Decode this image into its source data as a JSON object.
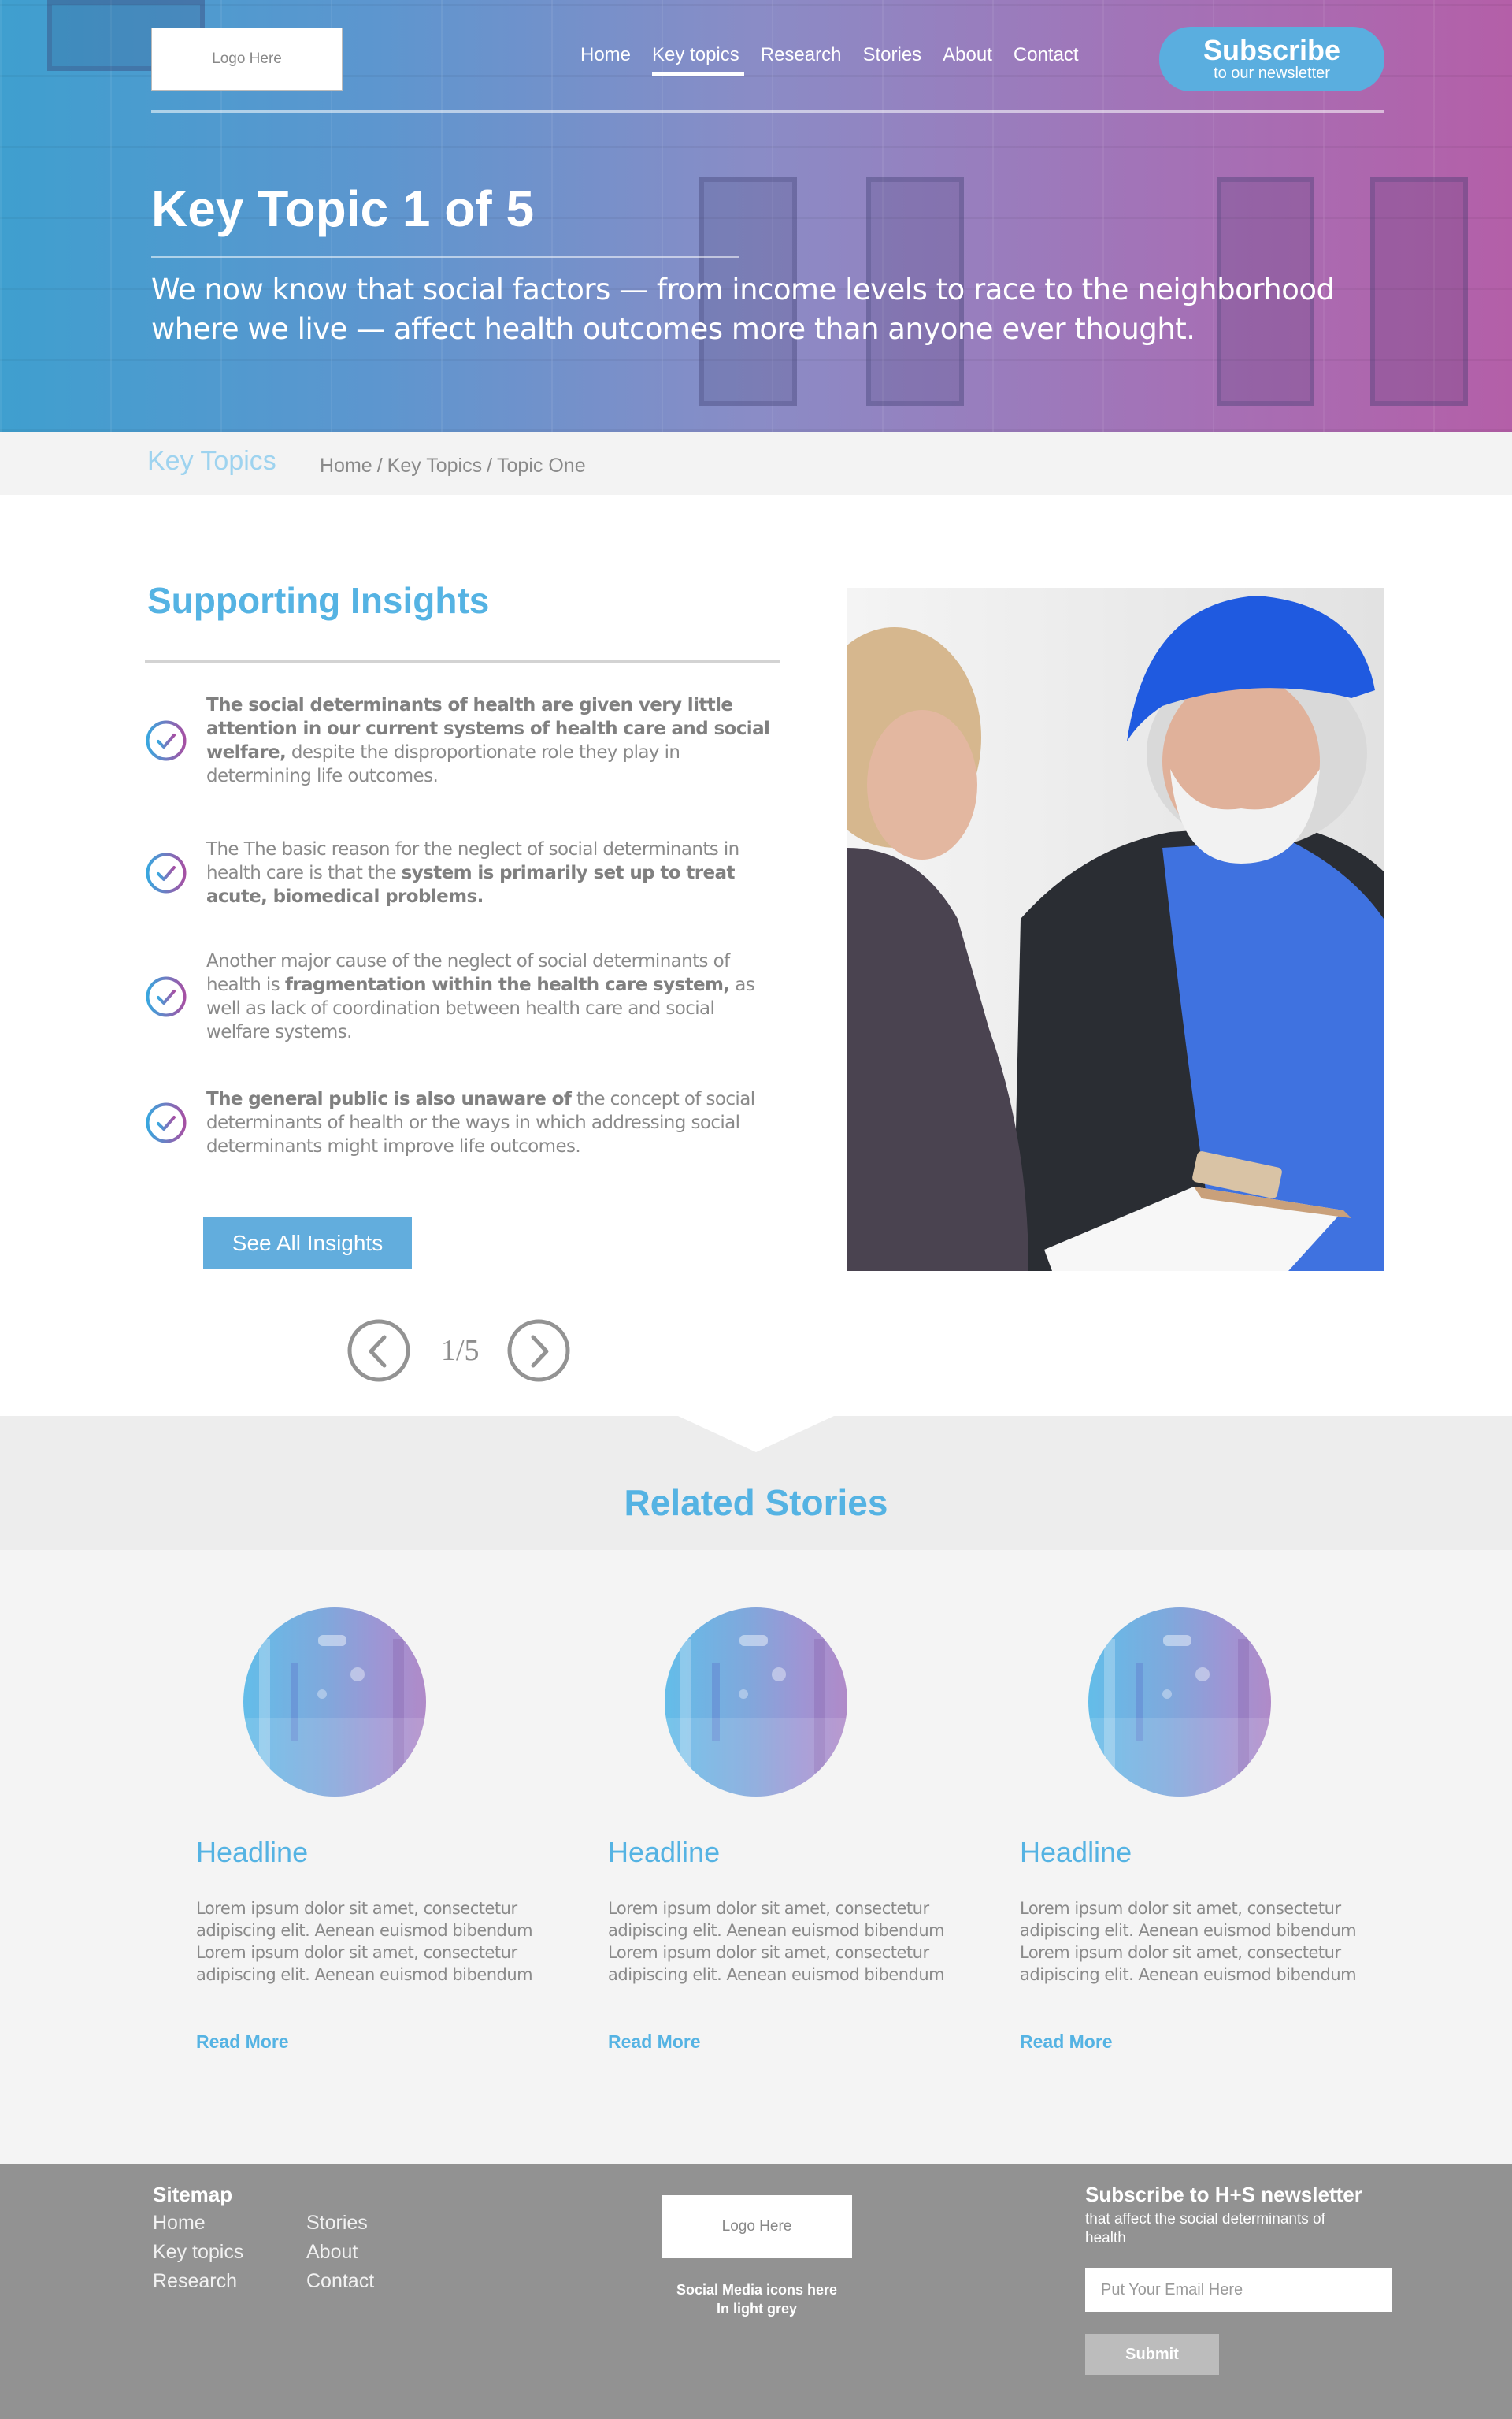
{
  "header": {
    "logo_text": "Logo Here",
    "nav": [
      {
        "label": "Home",
        "active": false
      },
      {
        "label": "Key topics",
        "active": true
      },
      {
        "label": "Research",
        "active": false
      },
      {
        "label": "Stories",
        "active": false
      },
      {
        "label": "About",
        "active": false
      },
      {
        "label": "Contact",
        "active": false
      }
    ],
    "subscribe": {
      "title": "Subscribe",
      "subtitle": "to our newsletter"
    }
  },
  "hero": {
    "title": "Key Topic 1 of 5",
    "description": "We now know that social factors — from income levels to race to the neighborhood where we live — affect health outcomes more than anyone ever thought."
  },
  "crumb_bar": {
    "section_title": "Key Topics",
    "breadcrumb": [
      "Home",
      "Key Topics",
      "Topic One"
    ],
    "separator": "/"
  },
  "insights": {
    "title": "Supporting Insights",
    "items": [
      {
        "segments": [
          {
            "text": "The social determinants of health are given very little attention in our current systems of health care and social welfare,",
            "bold": true
          },
          {
            "text": " despite the disproportionate role they play in determining life outcomes.",
            "bold": false
          }
        ]
      },
      {
        "segments": [
          {
            "text": "The The basic reason for the neglect of social determinants in health care is that the ",
            "bold": false
          },
          {
            "text": "system is primarily set up to treat acute, biomedical problems.",
            "bold": true
          }
        ]
      },
      {
        "segments": [
          {
            "text": "Another major cause of the neglect of social determinants of health is ",
            "bold": false
          },
          {
            "text": "fragmentation within the health care system,",
            "bold": true
          },
          {
            "text": " as well as lack of coordination between health care and social welfare systems.",
            "bold": false
          }
        ]
      },
      {
        "segments": [
          {
            "text": "The general public is also unaware of",
            "bold": true
          },
          {
            "text": " the concept of social determinants of health or the ways in which addressing social determinants might improve life outcomes.",
            "bold": false
          }
        ]
      }
    ],
    "see_all_label": "See All Insights",
    "pager": {
      "current": 1,
      "total": 5,
      "label": "1/5"
    }
  },
  "related": {
    "title": "Related Stories",
    "stories": [
      {
        "headline": "Headline",
        "body": "Lorem ipsum dolor sit amet, consectetur adipiscing elit. Aenean euismod bibendum Lorem ipsum dolor sit amet, consectetur adipiscing elit. Aenean euismod bibendum",
        "link": "Read More"
      },
      {
        "headline": "Headline",
        "body": "Lorem ipsum dolor sit amet, consectetur adipiscing elit. Aenean euismod bibendum Lorem ipsum dolor sit amet, consectetur adipiscing elit. Aenean euismod bibendum",
        "link": "Read More"
      },
      {
        "headline": "Headline",
        "body": "Lorem ipsum dolor sit amet, consectetur adipiscing elit. Aenean euismod bibendum Lorem ipsum dolor sit amet, consectetur adipiscing elit. Aenean euismod bibendum",
        "link": "Read More"
      }
    ]
  },
  "footer": {
    "sitemap_title": "Sitemap",
    "sitemap_col1": [
      "Home",
      "Key topics",
      "Research"
    ],
    "sitemap_col2": [
      "Stories",
      "About",
      "Contact"
    ],
    "logo_text": "Logo Here",
    "social_note_line1": "Social Media icons here",
    "social_note_line2": "In light grey",
    "newsletter": {
      "title": "Subscribe to H+S newsletter",
      "subtitle": "that affect the social determinants of health",
      "email_placeholder": "Put Your Email Here",
      "email_value": "",
      "submit_label": "Submit"
    }
  },
  "colors": {
    "accent_blue": "#55b3e3",
    "button_blue": "#62addd",
    "gradient_start": "#3f9fcf",
    "gradient_end": "#b45fa8",
    "footer_grey": "#929292",
    "text_grey": "#8a8a8a"
  },
  "icons": {
    "insight_bullet": "check-circle-icon",
    "pager_prev": "chevron-left-circle-icon",
    "pager_next": "chevron-right-circle-icon"
  }
}
